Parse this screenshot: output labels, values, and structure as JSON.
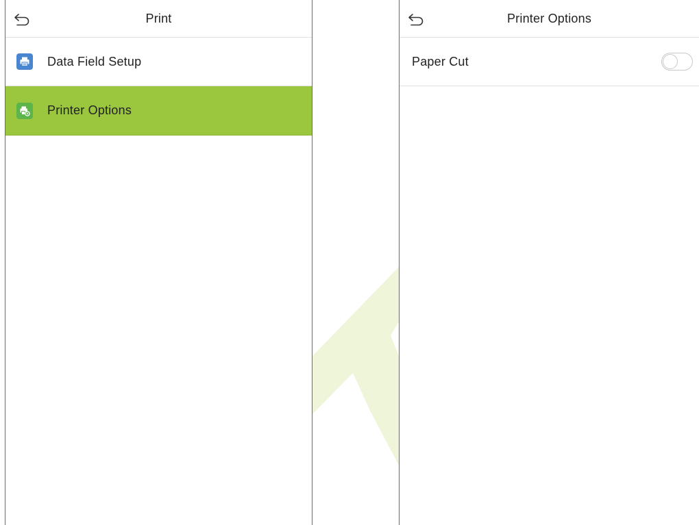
{
  "colors": {
    "accent_green": "#9bc73f",
    "icon_blue": "#4a86cf",
    "icon_green": "#5db44a"
  },
  "left_screen": {
    "back_icon": "back-arrow-icon",
    "title": "Print",
    "items": [
      {
        "label": "Data Field Setup",
        "icon": "printer-icon",
        "selected": false
      },
      {
        "label": "Printer Options",
        "icon": "printer-settings-icon",
        "selected": true
      }
    ]
  },
  "right_screen": {
    "back_icon": "back-arrow-icon",
    "title": "Printer Options",
    "settings": [
      {
        "label": "Paper Cut",
        "type": "toggle",
        "value": false
      }
    ]
  }
}
